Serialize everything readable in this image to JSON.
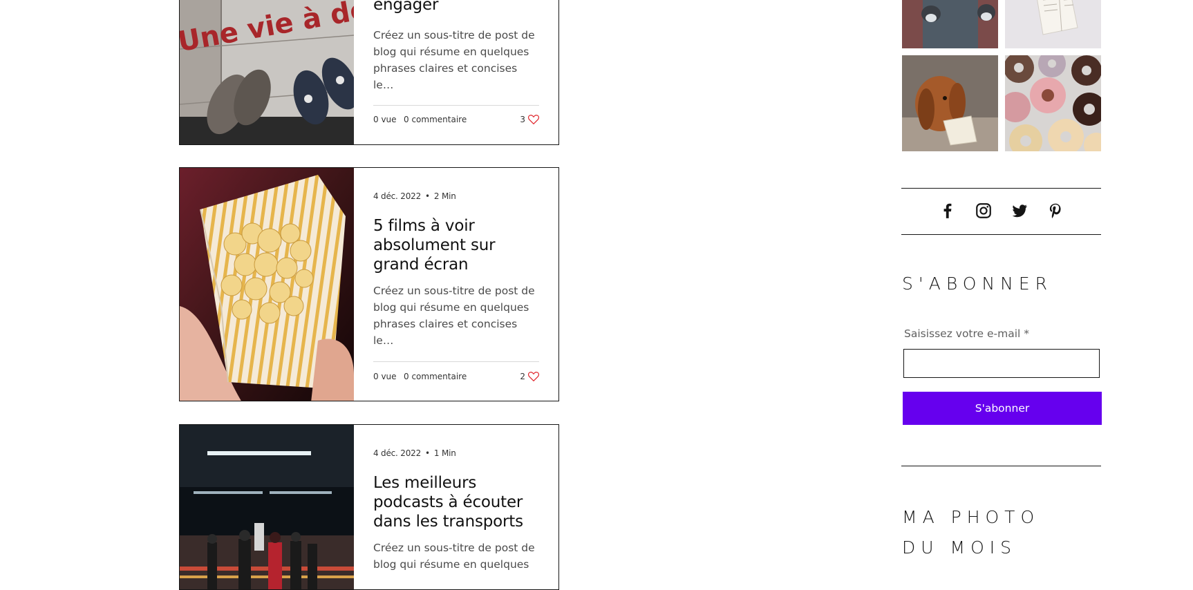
{
  "posts": [
    {
      "date": "",
      "read_time": "",
      "title": "engager",
      "excerpt": "Créez un sous-titre de post de blog qui résume en quelques phrases claires et concises le…",
      "views": "0 vue",
      "comments": "0 commentaire",
      "likes": "3",
      "image_sign_text": "Une vie à de"
    },
    {
      "date": "4 déc. 2022",
      "read_time": "2 Min",
      "title": "5 films à voir absolument sur grand écran",
      "excerpt": "Créez un sous-titre de post de blog qui résume en quelques phrases claires et concises le…",
      "views": "0 vue",
      "comments": "0 commentaire",
      "likes": "2"
    },
    {
      "date": "4 déc. 2022",
      "read_time": "1 Min",
      "title": "Les meilleurs podcasts à écouter dans les transports",
      "excerpt": "Créez un sous-titre de post de blog qui résume en quelques"
    }
  ],
  "meta_separator": "•",
  "sidebar": {
    "gallery_icons": [
      "feet-photo",
      "book-photo",
      "dog-photo",
      "donuts-photo"
    ],
    "social_icons": [
      "facebook-icon",
      "instagram-icon",
      "twitter-icon",
      "pinterest-icon"
    ],
    "subscribe": {
      "heading": "S'ABONNER",
      "email_label": "Saisissez votre e-mail *",
      "email_value": "",
      "button_label": "S'abonner"
    },
    "photo_heading_line1": "MA PHOTO",
    "photo_heading_line2": "DU MOIS"
  },
  "colors": {
    "accent": "#6600ee",
    "heart": "#e0262d",
    "border": "#151515"
  }
}
